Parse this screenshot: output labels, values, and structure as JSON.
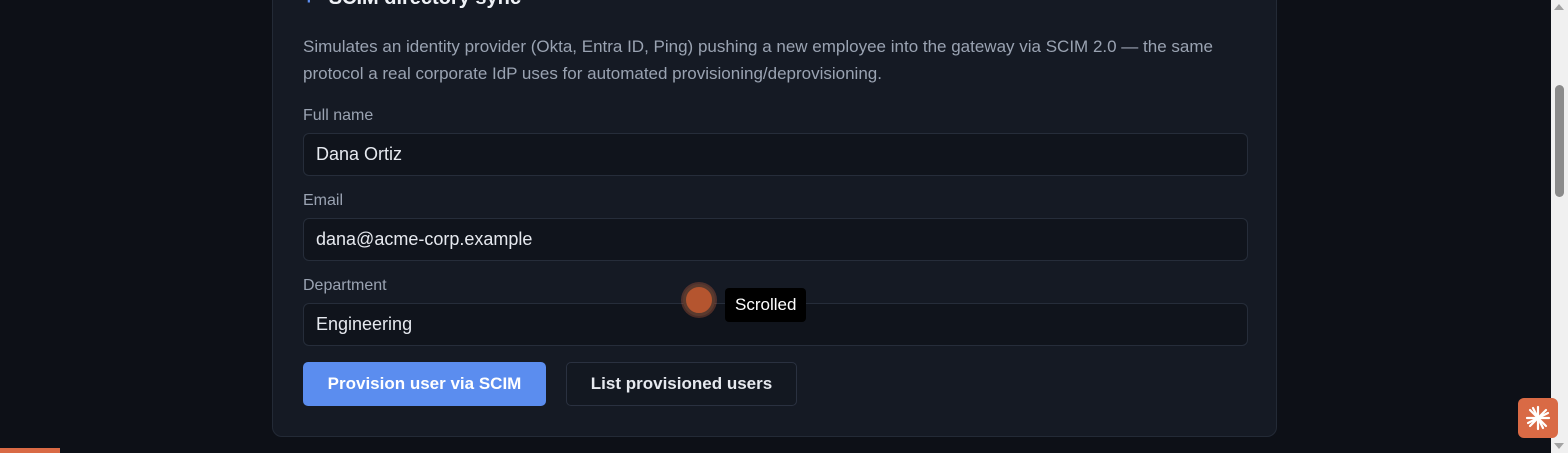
{
  "section": {
    "icon": "plus-icon",
    "icon_glyph": "+",
    "title": "SCIM directory sync",
    "description": "Simulates an identity provider (Okta, Entra ID, Ping) pushing a new employee into the gateway via SCIM 2.0 — the same protocol a real corporate IdP uses for automated provisioning/deprovisioning."
  },
  "form": {
    "full_name": {
      "label": "Full name",
      "value": "Dana Ortiz"
    },
    "email": {
      "label": "Email",
      "value": "dana@acme-corp.example"
    },
    "department": {
      "label": "Department",
      "value": "Engineering"
    }
  },
  "actions": {
    "provision_label": "Provision user via SCIM",
    "list_label": "List provisioned users"
  },
  "overlay": {
    "tooltip_text": "Scrolled"
  },
  "colors": {
    "page_bg": "#0d1017",
    "card_bg": "#151a24",
    "accent": "#5b8def",
    "muted_text": "#9aa3b2",
    "widget": "#d96a45"
  }
}
